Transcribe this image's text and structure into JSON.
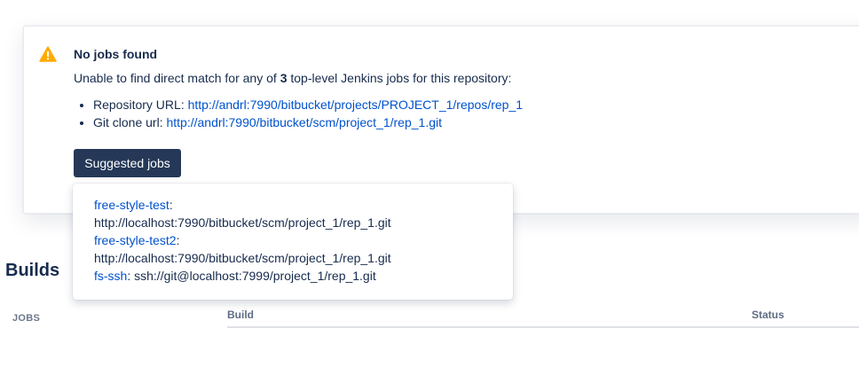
{
  "alert": {
    "title": "No jobs found",
    "description_prefix": "Unable to find direct match for any of ",
    "job_count": "3",
    "description_suffix": " top-level Jenkins jobs for this repository:",
    "repo_url_label": "Repository URL: ",
    "repo_url": "http://andrl:7990/bitbucket/projects/PROJECT_1/repos/rep_1",
    "clone_url_label": "Git clone url: ",
    "clone_url": "http://andrl:7990/bitbucket/scm/project_1/rep_1.git",
    "suggest_button_label": "Suggested jobs",
    "icon": "warning-icon",
    "icon_color": "#ffab00"
  },
  "suggestions": [
    {
      "job": "free-style-test",
      "separator": ":",
      "url": "http://localhost:7990/bitbucket/scm/project_1/rep_1.git"
    },
    {
      "job": "free-style-test2",
      "separator": ":",
      "url": "http://localhost:7990/bitbucket/scm/project_1/rep_1.git"
    },
    {
      "job": "fs-ssh",
      "separator": ":",
      "url": "ssh://git@localhost:7999/project_1/rep_1.git"
    }
  ],
  "builds": {
    "title": "Builds",
    "jobs_header": "JOBS",
    "columns": [
      "Build",
      "Status"
    ]
  },
  "colors": {
    "link": "#0052cc",
    "button_bg": "#253858",
    "text": "#172b4d"
  }
}
